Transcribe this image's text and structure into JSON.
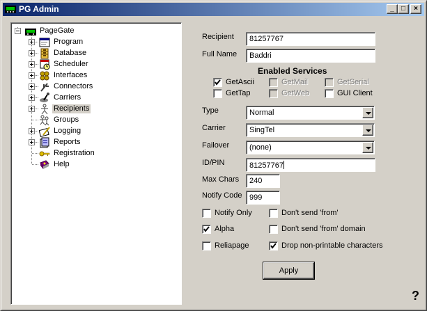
{
  "window": {
    "title": "PG Admin"
  },
  "titlebar_buttons": {
    "minimize": "_",
    "maximize": "□",
    "close": "×"
  },
  "tree": {
    "root": "PageGate",
    "items": [
      {
        "label": "Program",
        "icon": "program-icon",
        "expandable": true
      },
      {
        "label": "Database",
        "icon": "database-icon",
        "expandable": true
      },
      {
        "label": "Scheduler",
        "icon": "scheduler-icon",
        "expandable": true
      },
      {
        "label": "Interfaces",
        "icon": "interfaces-icon",
        "expandable": true
      },
      {
        "label": "Connectors",
        "icon": "connectors-icon",
        "expandable": true
      },
      {
        "label": "Carriers",
        "icon": "carriers-icon",
        "expandable": true
      },
      {
        "label": "Recipients",
        "icon": "recipients-icon",
        "expandable": true,
        "selected": true
      },
      {
        "label": "Groups",
        "icon": "groups-icon",
        "expandable": false
      },
      {
        "label": "Logging",
        "icon": "logging-icon",
        "expandable": true
      },
      {
        "label": "Reports",
        "icon": "reports-icon",
        "expandable": true
      },
      {
        "label": "Registration",
        "icon": "key-icon",
        "expandable": false
      },
      {
        "label": "Help",
        "icon": "help-book-icon",
        "expandable": false
      }
    ]
  },
  "form": {
    "recipient_label": "Recipient",
    "recipient_value": "81257767",
    "fullname_label": "Full Name",
    "fullname_value": "Baddri",
    "services_title": "Enabled Services",
    "services": [
      {
        "label": "GetAscii",
        "checked": true,
        "enabled": true
      },
      {
        "label": "GetMail",
        "checked": false,
        "enabled": false
      },
      {
        "label": "GetSerial",
        "checked": false,
        "enabled": false
      },
      {
        "label": "GetTap",
        "checked": false,
        "enabled": true
      },
      {
        "label": "GetWeb",
        "checked": false,
        "enabled": false
      },
      {
        "label": "GUI Client",
        "checked": false,
        "enabled": true
      }
    ],
    "type_label": "Type",
    "type_value": "Normal",
    "carrier_label": "Carrier",
    "carrier_value": "SingTel",
    "failover_label": "Failover",
    "failover_value": "(none)",
    "idpin_label": "ID/PIN",
    "idpin_value": "81257767",
    "maxchars_label": "Max Chars",
    "maxchars_value": "240",
    "notifycode_label": "Notify Code",
    "notifycode_value": "999",
    "options": [
      {
        "label": "Notify Only",
        "checked": false
      },
      {
        "label": "Don't send 'from'",
        "checked": false
      },
      {
        "label": "Alpha",
        "checked": true
      },
      {
        "label": "Don't send 'from' domain",
        "checked": false
      },
      {
        "label": "Reliapage",
        "checked": false
      },
      {
        "label": "Drop non-printable characters",
        "checked": true
      }
    ],
    "apply_label": "Apply"
  },
  "help_mark": "?"
}
